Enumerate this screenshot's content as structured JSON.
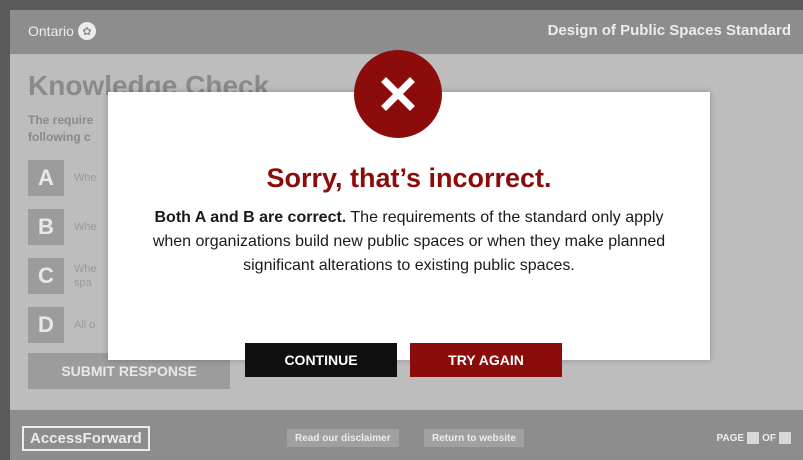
{
  "header": {
    "brand": "Ontario",
    "course_title": "Design of Public Spaces Standard"
  },
  "main": {
    "title": "Knowledge Check",
    "question": "The requirements ... following c...",
    "options": [
      {
        "letter": "A",
        "text": "Whe"
      },
      {
        "letter": "B",
        "text": "Whe"
      },
      {
        "letter": "C",
        "text": "Whe spa"
      },
      {
        "letter": "D",
        "text": "All o"
      }
    ],
    "submit_label": "SUBMIT RESPONSE"
  },
  "modal": {
    "headline": "Sorry, that’s incorrect.",
    "feedback_bold": "Both A and B are correct.",
    "feedback_rest": " The requirements of the standard only apply when organizations build new public spaces or when they make planned significant alterations to existing public spaces.",
    "continue_label": "CONTINUE",
    "try_again_label": "TRY AGAIN"
  },
  "footer": {
    "logo": "AccessForward",
    "disclaimer_label": "Read our disclaimer",
    "return_label": "Return to website",
    "page_label": "PAGE",
    "of_label": "OF"
  },
  "colors": {
    "accent": "#8c0c0c",
    "overlay_gray": "#bdbdbd"
  },
  "icons": [
    "ontario-trillium-icon",
    "close-x-icon"
  ]
}
